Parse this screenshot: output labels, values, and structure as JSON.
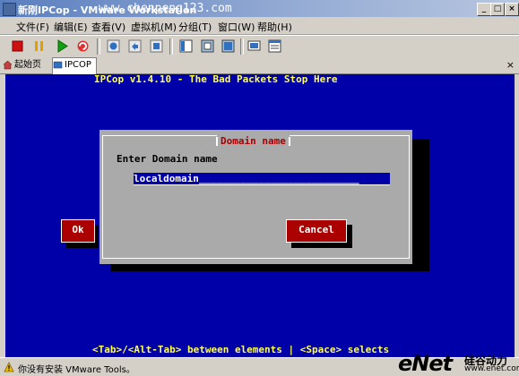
{
  "window": {
    "title": "新刚IPCop - VMware Workstation",
    "watermark": "www.chenpeng123.com",
    "controls": [
      "_",
      "□",
      "×"
    ]
  },
  "menu": [
    {
      "label": "文件(F)"
    },
    {
      "label": "编辑(E)"
    },
    {
      "label": "查看(V)"
    },
    {
      "label": "虚拟机(M)"
    },
    {
      "label": "分组(T)"
    },
    {
      "label": "窗口(W)"
    },
    {
      "label": "帮助(H)"
    }
  ],
  "toolbar": {
    "buttons": [
      {
        "icon": "power-off-icon",
        "color": "#d01010"
      },
      {
        "icon": "pause-icon",
        "color": "#e0a000"
      },
      {
        "icon": "power-on-icon",
        "color": "#10a010"
      },
      {
        "icon": "reset-icon",
        "color": "#10a010"
      },
      {
        "icon": "snapshot-icon",
        "color": "#3070c0"
      },
      {
        "icon": "revert-snapshot-icon",
        "color": "#3070c0"
      },
      {
        "icon": "snapshot-manager-icon",
        "color": "#3070c0"
      },
      {
        "icon": "sidebar-icon",
        "color": "#3070c0"
      },
      {
        "icon": "quick-switch-icon",
        "color": "#3070c0"
      },
      {
        "icon": "full-screen-icon",
        "color": "#3070c0"
      },
      {
        "icon": "console-view-icon",
        "color": "#3070c0"
      },
      {
        "icon": "summary-view-icon",
        "color": "#3070c0"
      }
    ]
  },
  "tabs": [
    {
      "label": "起始页",
      "active": false
    },
    {
      "label": "IPCOP",
      "active": true
    }
  ],
  "console": {
    "header": "IPCop v1.4.10 - The Bad Packets Stop Here",
    "footer": "<Tab>/<Alt-Tab> between elements   |  <Space> selects",
    "colors": {
      "background": "#0000a8",
      "dialog": "#aaaaaa",
      "button": "#aa0000",
      "accent": "#ffff55"
    },
    "dialog": {
      "title": "Domain name",
      "prompt": "Enter Domain name",
      "input_value": "localdomain",
      "input_fill": "___________________________",
      "ok_label": "Ok",
      "cancel_label": "Cancel"
    }
  },
  "status": {
    "text": "你没有安装 VMware Tools。",
    "brand_logo": "eNet",
    "brand_cn": "硅谷动力",
    "brand_url": "www.enet.com.cn"
  }
}
